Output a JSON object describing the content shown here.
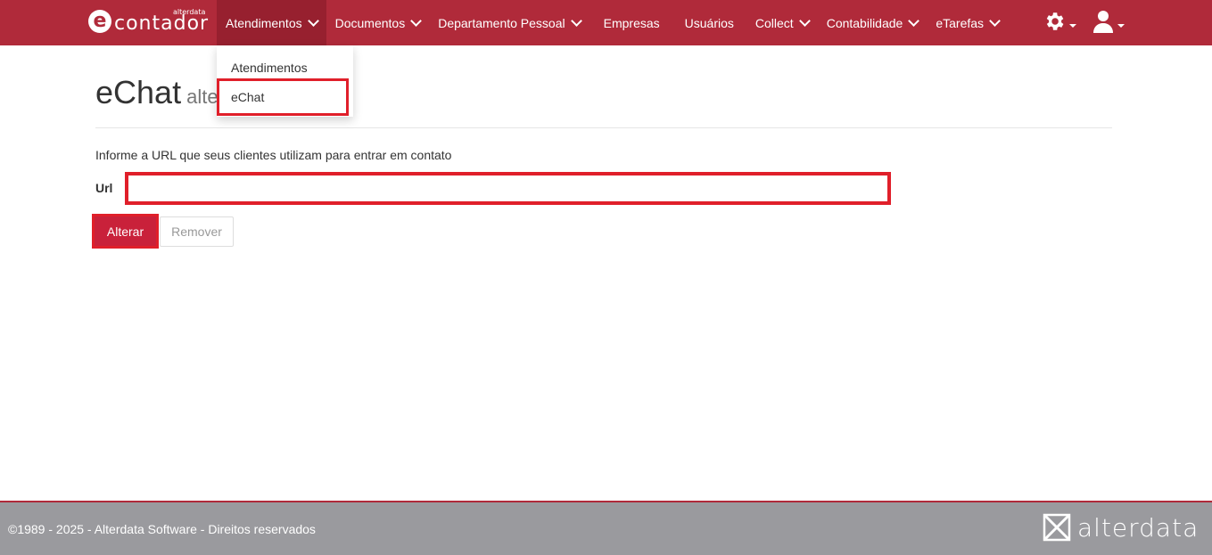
{
  "brand": {
    "logo_letter": "e",
    "name": "contador",
    "small": "alterdata"
  },
  "nav": {
    "items": [
      {
        "label": "Atendimentos",
        "has_dropdown": true
      },
      {
        "label": "Documentos",
        "has_dropdown": true
      },
      {
        "label": "Departamento Pessoal",
        "has_dropdown": true
      },
      {
        "label": "Empresas",
        "has_dropdown": false
      },
      {
        "label": "Usuários",
        "has_dropdown": false
      },
      {
        "label": "Collect",
        "has_dropdown": true
      },
      {
        "label": "Contabilidade",
        "has_dropdown": true
      },
      {
        "label": "eTarefas",
        "has_dropdown": true
      }
    ],
    "active": "Atendimentos",
    "right_icons": [
      "gear-icon",
      "user-icon"
    ]
  },
  "dropdown": {
    "items": [
      "Atendimentos",
      "eChat"
    ],
    "highlighted": "eChat"
  },
  "page": {
    "title": "eChat",
    "subtitle": "alte",
    "help_text": "Informe a URL que seus clientes utilizam para entrar em contato",
    "url_label": "Url",
    "url_value": "",
    "alterar_label": "Alterar",
    "remover_label": "Remover"
  },
  "footer": {
    "text": "©1989 - 2025 - Alterdata Software - Direitos reservados",
    "logo": "alterdata"
  },
  "colors": {
    "navbar": "#b02a3a",
    "accent": "#c9213a",
    "highlight": "#e01f2a",
    "footer": "#9a9a9e"
  }
}
